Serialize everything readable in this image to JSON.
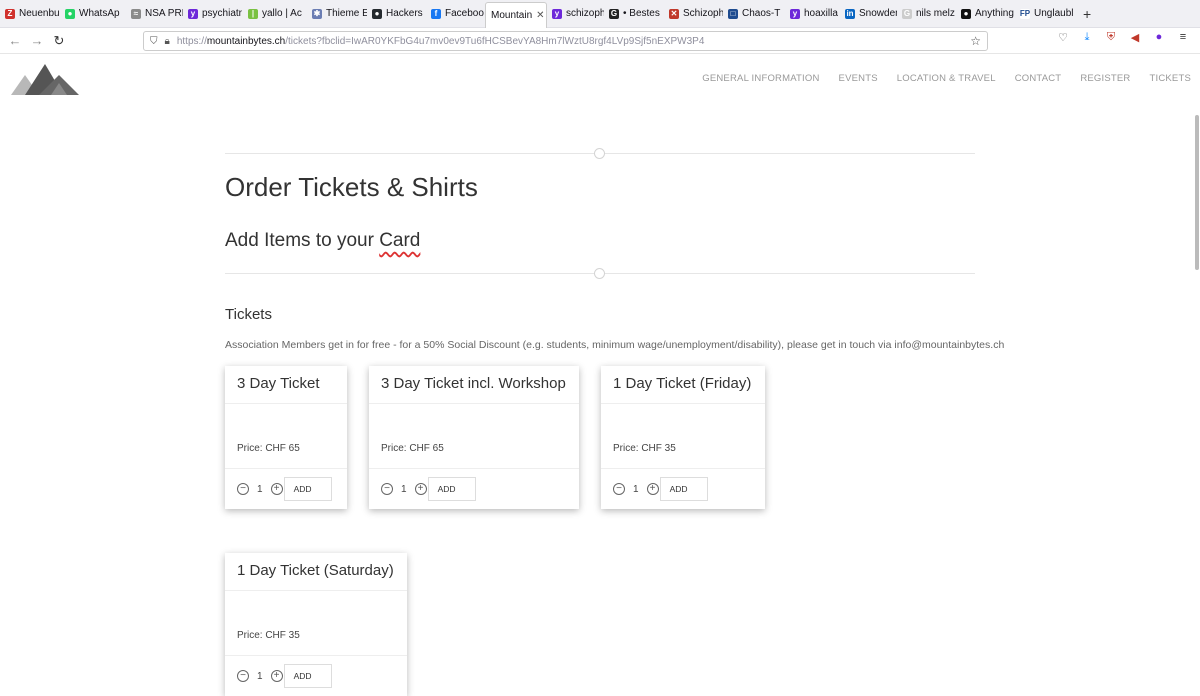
{
  "tabs": [
    {
      "label": "Neuenbu",
      "color": "#d0312d",
      "glyph": "Z"
    },
    {
      "label": "WhatsAp",
      "color": "#25d366",
      "glyph": "●"
    },
    {
      "label": "NSA PRI",
      "color": "#8a8a8a",
      "glyph": "≈"
    },
    {
      "label": "psychiatr",
      "color": "#6d28d9",
      "glyph": "y"
    },
    {
      "label": "yallo | Ac",
      "color": "#7ac142",
      "glyph": "|"
    },
    {
      "label": "Thieme E",
      "color": "#6b7db3",
      "glyph": "✱"
    },
    {
      "label": "Hackers",
      "color": "#24292e",
      "glyph": "●"
    },
    {
      "label": "Faceboo",
      "color": "#1877f2",
      "glyph": "f"
    },
    {
      "label": "Mountain",
      "color": "#ffffff",
      "glyph": "",
      "active": true
    },
    {
      "label": "schizoph",
      "color": "#6d28d9",
      "glyph": "y"
    },
    {
      "label": "• Bestes",
      "color": "#222222",
      "glyph": "G"
    },
    {
      "label": "Schizoph",
      "color": "#c0392b",
      "glyph": "✕"
    },
    {
      "label": "Chaos-T",
      "color": "#1e4b8f",
      "glyph": "□"
    },
    {
      "label": "hoaxilla",
      "color": "#6d28d9",
      "glyph": "y"
    },
    {
      "label": "Snowden",
      "color": "#0a66c2",
      "glyph": "in"
    },
    {
      "label": "nils melz",
      "color": "#cccccc",
      "glyph": "G"
    },
    {
      "label": "Anything",
      "color": "#111111",
      "glyph": "●"
    },
    {
      "label": "Unglaubl",
      "color": "#ffffff",
      "glyph": "FP"
    }
  ],
  "url": {
    "scheme": "https://",
    "domain": "mountainbytes.ch",
    "rest": "/tickets?fbclid=IwAR0YKFbG4u7mv0ev9Tu6fHCSBevYA8Hm7lWztU8rgf4LVp9Sjf5nEXPW3P4"
  },
  "nav": [
    "GENERAL INFORMATION",
    "EVENTS",
    "LOCATION & TRAVEL",
    "CONTACT",
    "REGISTER",
    "TICKETS"
  ],
  "heading": "Order Tickets & Shirts",
  "subheading_a": "Add Items to your ",
  "subheading_b": "Card",
  "section": "Tickets",
  "note": "Association Members get in for free - for a 50% Social Discount (e.g. students, minimum wage/unemployment/disability), please get in touch via info@mountainbytes.ch",
  "tickets": [
    {
      "name": "3 Day Ticket",
      "price": "Price: CHF 65",
      "qty": "1",
      "add": "ADD"
    },
    {
      "name": "3 Day Ticket incl. Workshop",
      "price": "Price: CHF 65",
      "qty": "1",
      "add": "ADD"
    },
    {
      "name": "1 Day Ticket (Friday)",
      "price": "Price: CHF 35",
      "qty": "1",
      "add": "ADD"
    },
    {
      "name": "1 Day Ticket (Saturday)",
      "price": "Price: CHF 35",
      "qty": "1",
      "add": "ADD"
    }
  ]
}
